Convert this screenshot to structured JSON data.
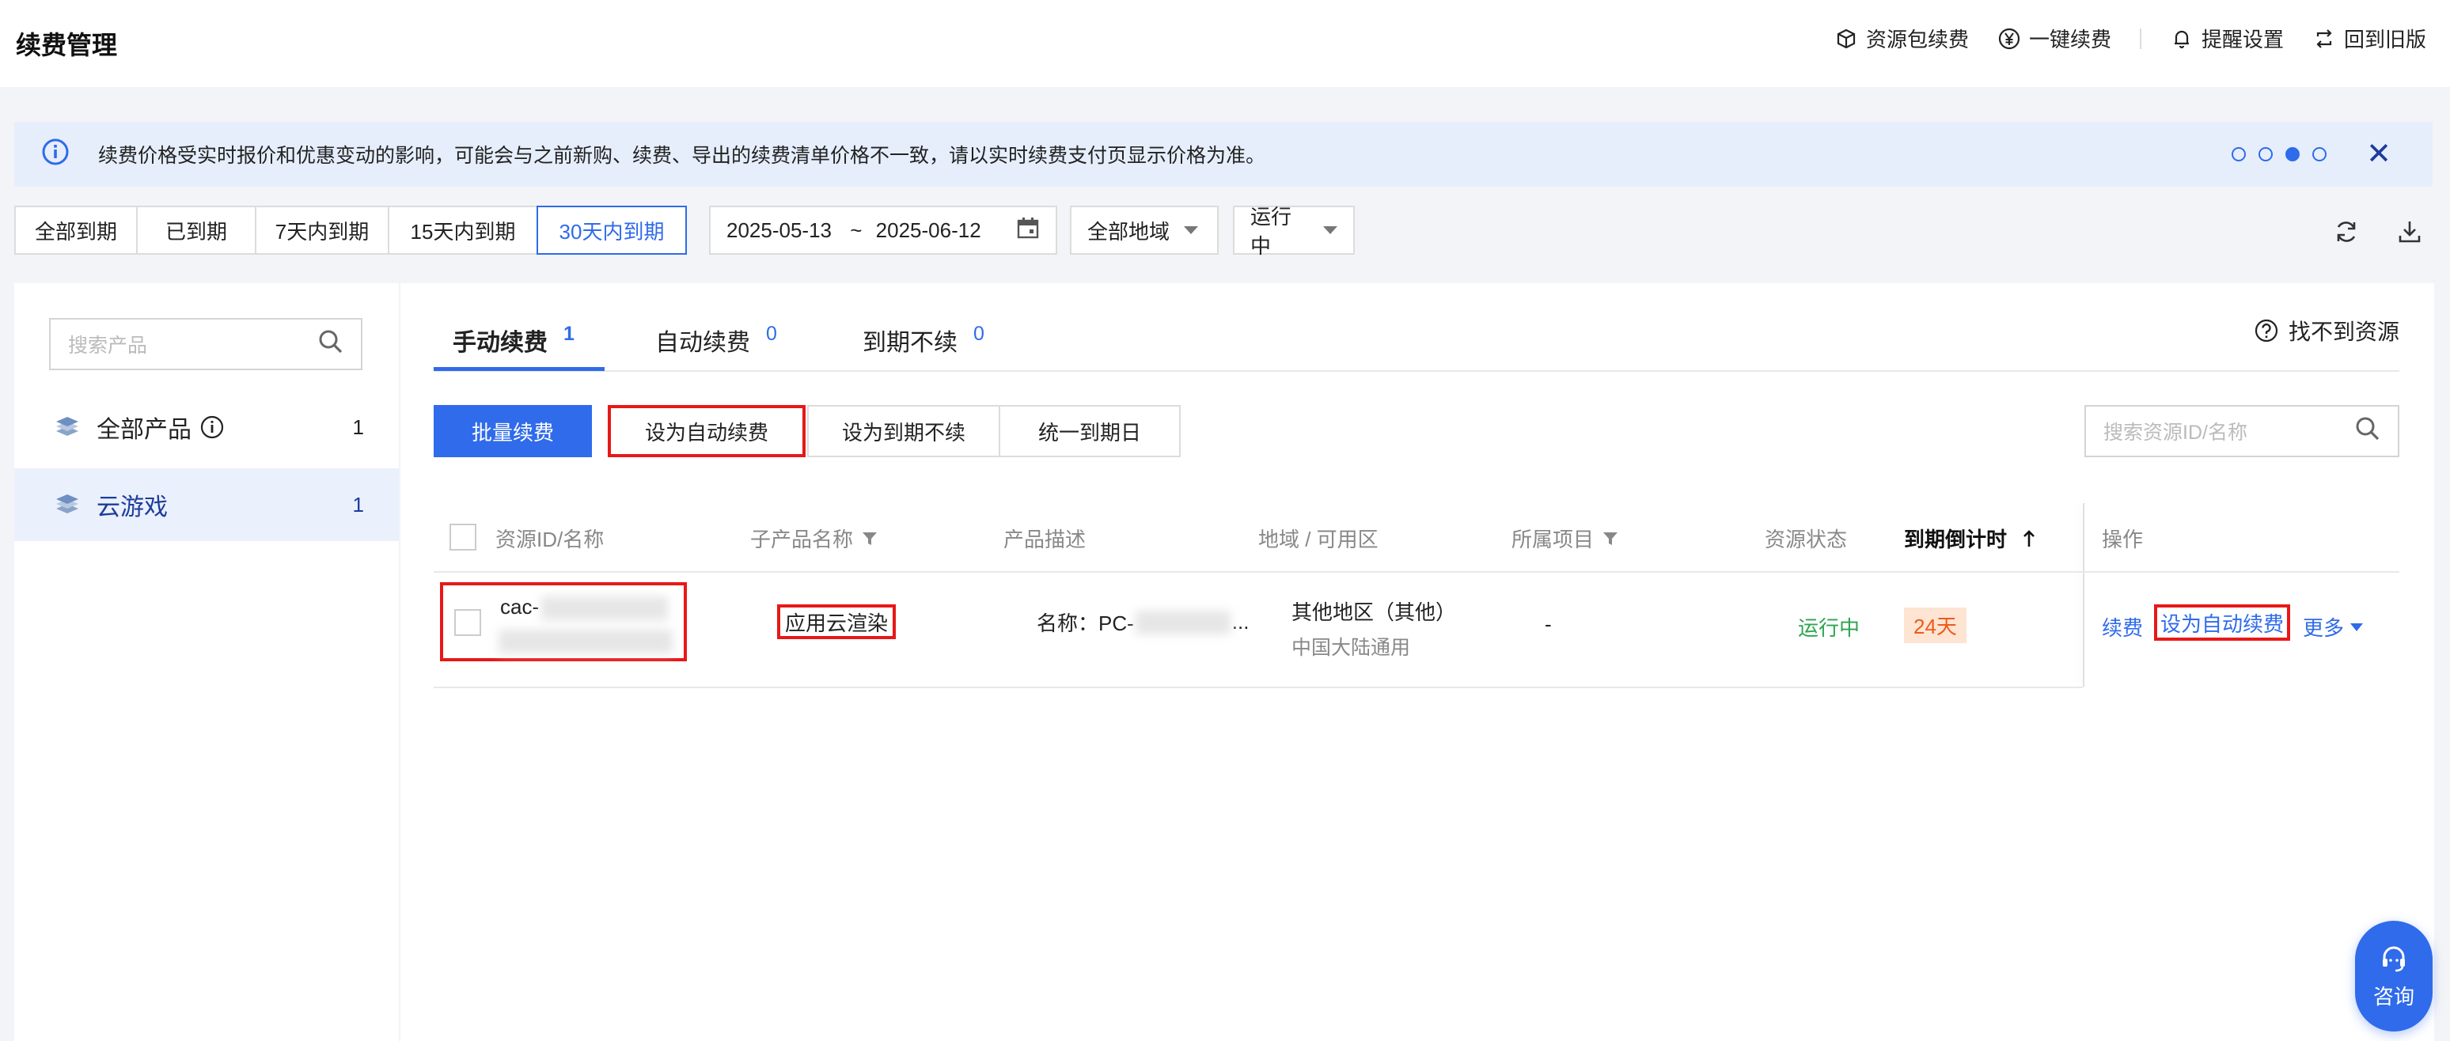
{
  "header": {
    "title": "续费管理",
    "actions": [
      {
        "label": "资源包续费",
        "icon": "package-icon"
      },
      {
        "label": "一键续费",
        "icon": "yen-icon"
      },
      {
        "label": "提醒设置",
        "icon": "bell-icon"
      },
      {
        "label": "回到旧版",
        "icon": "switch-icon"
      }
    ]
  },
  "notice": {
    "text": "续费价格受实时报价和优惠变动的影响，可能会与之前新购、续费、导出的续费清单价格不一致，请以实时续费支付页显示价格为准。",
    "dots": 4,
    "active_dot": 3
  },
  "filters": {
    "expiry_tabs": [
      "全部到期",
      "已到期",
      "7天内到期",
      "15天内到期",
      "30天内到期"
    ],
    "active_expiry": "30天内到期",
    "date_start": "2025-05-13",
    "date_sep": "~",
    "date_end": "2025-06-12",
    "region": "全部地域",
    "status": "运行中"
  },
  "sidebar": {
    "search_placeholder": "搜索产品",
    "items": [
      {
        "label": "全部产品",
        "count": "1"
      },
      {
        "label": "云游戏",
        "count": "1"
      }
    ]
  },
  "tabs": [
    {
      "label": "手动续费",
      "count": "1"
    },
    {
      "label": "自动续费",
      "count": "0"
    },
    {
      "label": "到期不续",
      "count": "0"
    }
  ],
  "help_link": "找不到资源",
  "toolbar": {
    "batch_renew": "批量续费",
    "set_auto": "设为自动续费",
    "set_no_renew": "设为到期不续",
    "unify_date": "统一到期日",
    "search_placeholder": "搜索资源ID/名称"
  },
  "table": {
    "columns": [
      "资源ID/名称",
      "子产品名称",
      "产品描述",
      "地域 / 可用区",
      "所属项目",
      "资源状态",
      "到期倒计时",
      "操作"
    ],
    "rows": [
      {
        "id": "cac-",
        "subproduct": "应用云渲染",
        "desc_prefix": "名称：PC-",
        "desc_suffix": "...",
        "region": "其他地区（其他）",
        "zone": "中国大陆通用",
        "project": "-",
        "status": "运行中",
        "countdown": "24天",
        "actions": [
          "续费",
          "设为自动续费",
          "更多"
        ]
      }
    ]
  },
  "fab_label": "咨询",
  "colors": {
    "primary": "#2f6bea",
    "running": "#2ea44f",
    "countdown_bg": "#fde4d3",
    "countdown_text": "#f05a1a",
    "highlight": "#e81818"
  }
}
